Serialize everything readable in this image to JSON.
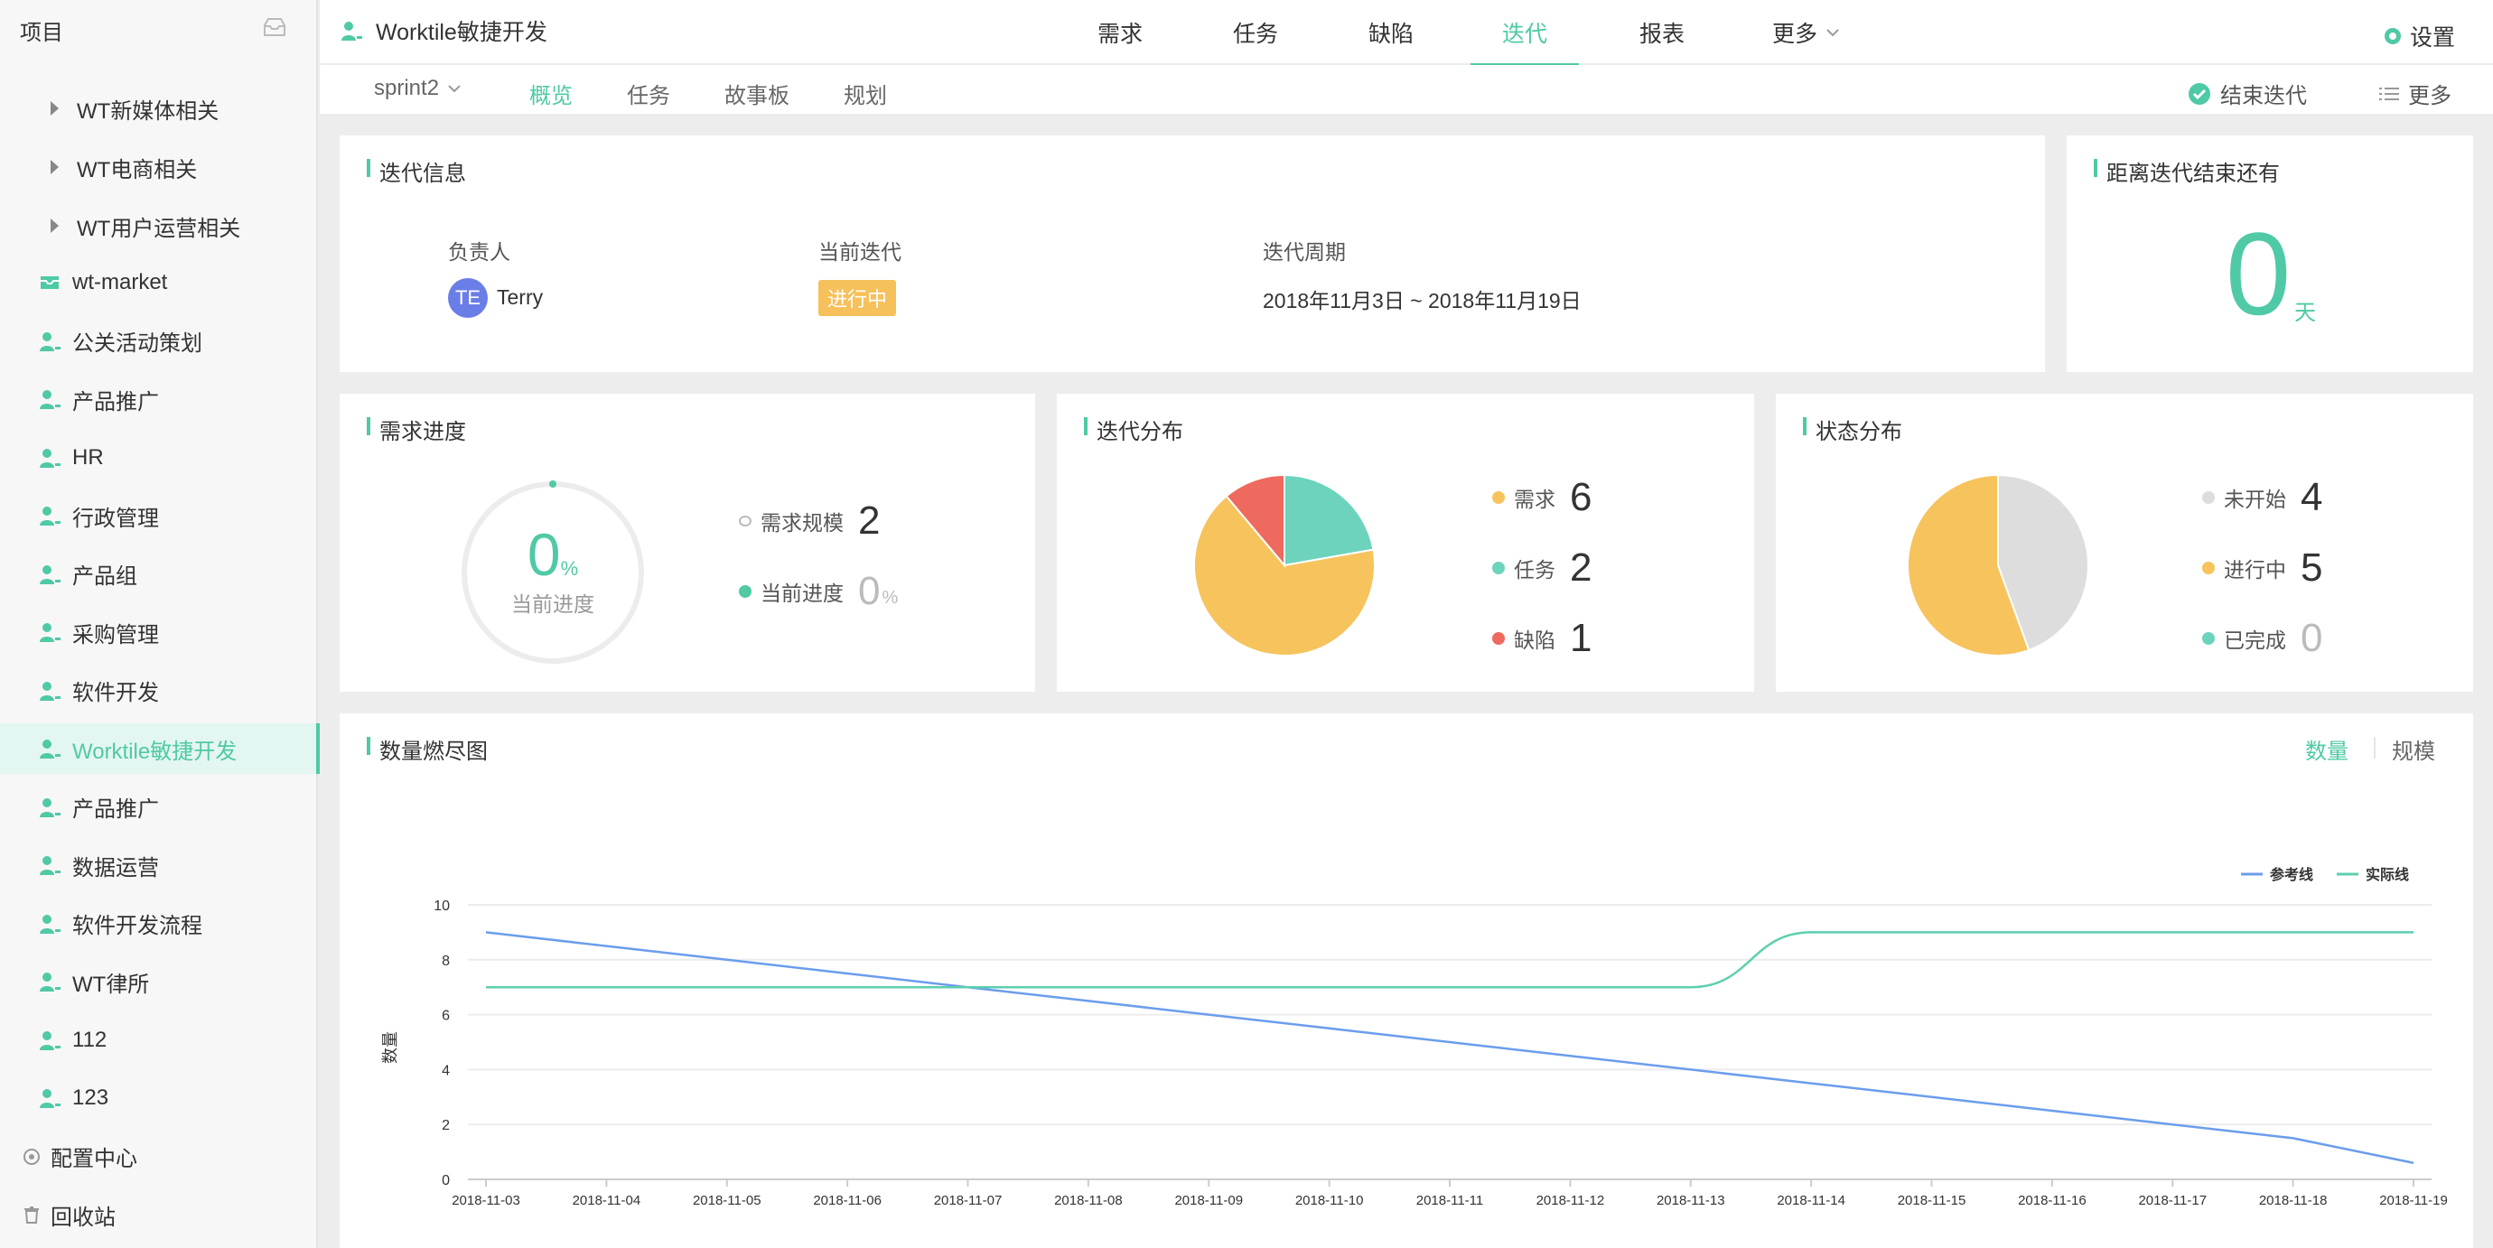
{
  "sidebar": {
    "header": "项目",
    "groups": [
      {
        "label": "WT新媒体相关"
      },
      {
        "label": "WT电商相关"
      },
      {
        "label": "WT用户运营相关"
      }
    ],
    "items": [
      {
        "label": "wt-market",
        "icon": "box-icon"
      },
      {
        "label": "公关活动策划",
        "icon": "person-icon"
      },
      {
        "label": "产品推广",
        "icon": "person-icon"
      },
      {
        "label": "HR",
        "icon": "person-icon"
      },
      {
        "label": "行政管理",
        "icon": "person-icon"
      },
      {
        "label": "产品组",
        "icon": "person-icon"
      },
      {
        "label": "采购管理",
        "icon": "person-icon"
      },
      {
        "label": "软件开发",
        "icon": "person-icon"
      },
      {
        "label": "Worktile敏捷开发",
        "icon": "person-icon",
        "active": true
      },
      {
        "label": "产品推广",
        "icon": "person-icon"
      },
      {
        "label": "数据运营",
        "icon": "person-icon"
      },
      {
        "label": "软件开发流程",
        "icon": "person-icon"
      },
      {
        "label": "WT律所",
        "icon": "person-icon"
      },
      {
        "label": "112",
        "icon": "person-icon"
      },
      {
        "label": "123",
        "icon": "person-icon"
      }
    ],
    "footer": [
      {
        "label": "配置中心",
        "icon": "gear-icon"
      },
      {
        "label": "回收站",
        "icon": "trash-icon"
      }
    ]
  },
  "topbar": {
    "project": "Worktile敏捷开发",
    "nav": [
      "需求",
      "任务",
      "缺陷",
      "迭代",
      "报表",
      "更多"
    ],
    "active_nav": "迭代",
    "settings": "设置"
  },
  "subbar": {
    "sprint": "sprint2",
    "tabs": [
      "概览",
      "任务",
      "故事板",
      "规划"
    ],
    "active_tab": "概览",
    "end_sprint": "结束迭代",
    "more": "更多"
  },
  "info": {
    "title": "迭代信息",
    "owner_label": "负责人",
    "owner_initials": "TE",
    "owner_name": "Terry",
    "current_label": "当前迭代",
    "current_status": "进行中",
    "period_label": "迭代周期",
    "period": "2018年11月3日 ~ 2018年11月19日"
  },
  "remaining": {
    "title": "距离迭代结束还有",
    "value": "0",
    "unit": "天"
  },
  "progress": {
    "title": "需求进度",
    "percent": "0",
    "percent_unit": "%",
    "center_label": "当前进度",
    "scale_label": "需求规模",
    "scale_value": "2",
    "current_label": "当前进度",
    "current_value": "0",
    "current_unit": "%"
  },
  "distribution": {
    "title": "迭代分布",
    "items": [
      {
        "label": "需求",
        "value": 6,
        "color": "#f6c35d"
      },
      {
        "label": "任务",
        "value": 2,
        "color": "#6dd3bd"
      },
      {
        "label": "缺陷",
        "value": 1,
        "color": "#ee6a5e"
      }
    ]
  },
  "status": {
    "title": "状态分布",
    "items": [
      {
        "label": "未开始",
        "value": 4,
        "color": "#dddddd"
      },
      {
        "label": "进行中",
        "value": 5,
        "color": "#f6c35d"
      },
      {
        "label": "已完成",
        "value": 0,
        "color": "#6dd3bd"
      }
    ]
  },
  "burndown": {
    "title": "数量燃尽图",
    "toggle": [
      "数量",
      "规模"
    ],
    "active_toggle": "数量"
  },
  "colors": {
    "accent": "#4fc9a6",
    "reference_line": "#6b9ded",
    "actual_line": "#5ccfae"
  },
  "chart_data": {
    "type": "line",
    "title": "",
    "xlabel": "",
    "ylabel": "数量",
    "x": [
      "2018-11-03",
      "2018-11-04",
      "2018-11-05",
      "2018-11-06",
      "2018-11-07",
      "2018-11-08",
      "2018-11-09",
      "2018-11-10",
      "2018-11-11",
      "2018-11-12",
      "2018-11-13",
      "2018-11-14",
      "2018-11-15",
      "2018-11-16",
      "2018-11-17",
      "2018-11-18",
      "2018-11-19"
    ],
    "ylim": [
      0,
      10
    ],
    "yticks": [
      0,
      2,
      4,
      6,
      8,
      10
    ],
    "grid": true,
    "legend": "top-right",
    "series": [
      {
        "name": "参考线",
        "values": [
          9,
          8.5,
          8,
          7.5,
          7,
          6.5,
          6,
          5.5,
          5,
          4.5,
          4,
          3.5,
          3,
          2.5,
          2,
          1.5,
          0.6
        ]
      },
      {
        "name": "实际线",
        "values": [
          7,
          7,
          7,
          7,
          7,
          7,
          7,
          7,
          7,
          7,
          7,
          9,
          9,
          9,
          9,
          9,
          9
        ]
      }
    ]
  }
}
